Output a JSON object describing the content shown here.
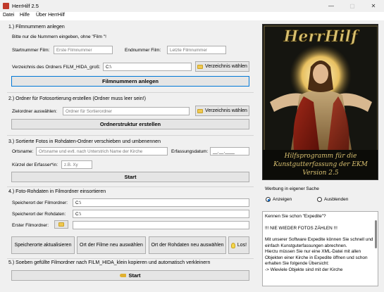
{
  "window": {
    "title": "HerrHilf 2.5",
    "controls": {
      "minimize": "—",
      "maximize": "▢",
      "close": "✕"
    }
  },
  "menu": {
    "items": [
      "Datei",
      "Hilfe",
      "Über HerrHilf"
    ]
  },
  "section1": {
    "title": "1.) Filmnummern anlegen",
    "hint": "Bitte nur die Nummern eingeben, ohne \"Film \"!",
    "start_label": "Startnummer Film:",
    "start_placeholder": "Erste Filmnummer",
    "end_label": "Endnummer Film:",
    "end_placeholder": "Letzte Filmnummer",
    "dir_label": "Verzeichnis des Ordners FILM_HIDA_groß:",
    "dir_value": "C:\\",
    "dir_button": "Verzeichnis wählen",
    "action_button": "Filmnummern anlegen"
  },
  "section2": {
    "title": "2.) Ordner für Fotosortierung erstellen (Ordner muss leer sein!)",
    "target_label": "Zielordner auswählen:",
    "target_placeholder": "Ordner für Sortierordner",
    "dir_button": "Verzeichnis wählen",
    "action_button": "Ordnerstruktur erstellen"
  },
  "section3": {
    "title": "3.) Sortierte Fotos in Rohdaten-Ordner verschieben und umbenennen",
    "place_label": "Ortsname:",
    "place_placeholder": "Ortsname und evtl. nach Unterstrich Name der Kirche",
    "date_label": "Erfassungsdatum:",
    "date_value": "__.__.____",
    "initials_label": "Kürzel der Erfasser*in:",
    "initials_placeholder": "z.B. Xy",
    "action_button": "Start"
  },
  "section4": {
    "title": "4.) Foto-Rohdaten in Filmordner einsortieren",
    "film_location_label": "Speicherort der Filmordner:",
    "film_location_value": "C:\\",
    "raw_location_label": "Speicherort der Rohdaten:",
    "raw_location_value": "C:\\",
    "first_folder_label": "Erster Filmordner:",
    "buttons": {
      "refresh": "Speicherorte aktualisieren",
      "choose_films": "Ort der Filme neu auswählen",
      "choose_raw": "Ort der Rohdaten neu auswählen",
      "go": "Los!"
    }
  },
  "section5": {
    "title": "5.) Soeben gefüllte Filmordner nach FILM_HIDA_klein kopieren und automatisch verkleinern",
    "action_button": "Start"
  },
  "poster": {
    "logo": "HerrHilf",
    "caption_lines": [
      "Hilfsprogramm für die",
      "Kunstgutterfassung der EKM",
      "Version 2.5"
    ]
  },
  "ads": {
    "title": "Werbung in eigener Sache",
    "show_label": "Anzeigen",
    "hide_label": "Ausblenden",
    "selected": "Anzeigen"
  },
  "textbox": {
    "lines": [
      "Kennen Sie schon \"Expedite\"?",
      "",
      "!!! NIE WIEDER FOTOS ZÄHLEN !!!",
      "",
      "Mit unserer Software Expedite können Sie schnell und einfach Kunstguterfassungen abrechnen.",
      "Hierzu müssen Sie nur eine XML-Datei mit allen Objekten einer Kirche in Expedite öffnen und schon erhalten Sie folgende Übersicht:",
      "-> Wieviele Objekte sind mit der Kirche"
    ]
  },
  "colors": {
    "accent": "#0078d7",
    "panel": "#f0f0f0",
    "button": "#e5e5e5"
  }
}
